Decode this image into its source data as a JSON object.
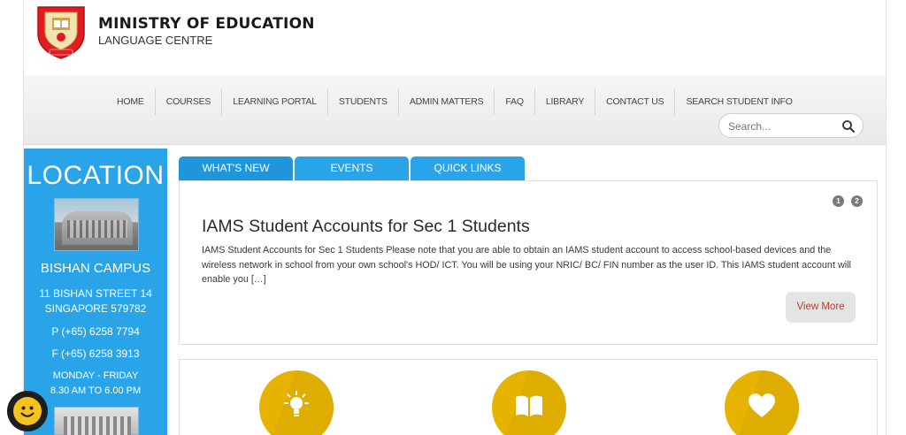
{
  "header": {
    "title": "MINISTRY OF EDUCATION",
    "subtitle": "LANGUAGE CENTRE",
    "logo_icon": "moe-crest-icon",
    "logo_text": "SINGAPORE"
  },
  "nav": {
    "items": [
      {
        "label": "HOME"
      },
      {
        "label": "COURSES"
      },
      {
        "label": "LEARNING PORTAL"
      },
      {
        "label": "STUDENTS"
      },
      {
        "label": "ADMIN MATTERS"
      },
      {
        "label": "FAQ"
      },
      {
        "label": "LIBRARY"
      },
      {
        "label": "CONTACT US"
      },
      {
        "label": "SEARCH STUDENT INFO"
      }
    ],
    "search": {
      "placeholder": "Search...",
      "icon": "search-icon"
    }
  },
  "sidebar": {
    "title": "LOCATION",
    "campus_name": "BISHAN CAMPUS",
    "address_line1": "11 BISHAN STREET 14",
    "address_line2": "SINGAPORE 579782",
    "phone": "P (+65) 6258 7794",
    "fax": "F (+65) 6258 3913",
    "hours_days": "MONDAY - FRIDAY",
    "hours_time": "8.30 AM TO 6.00 PM",
    "color": "#2aa4e8"
  },
  "tabs": [
    {
      "label": "WHAT'S NEW"
    },
    {
      "label": "EVENTS"
    },
    {
      "label": "QUICK LINKS"
    }
  ],
  "news": {
    "pager": [
      "1",
      "2"
    ],
    "title": "IAMS Student Accounts for Sec 1 Students",
    "body": "IAMS Student Accounts for Sec 1 Students Please note that you are able to obtain an IAMS student account to access school-based devices and the wireless network in school from your own school's HOD/ ICT. You will be using your NRIC/ BC/ FIN number as the user ID. This IAMS student account will enable you […]",
    "view_more": "View More"
  },
  "features": [
    {
      "icon": "lightbulb-icon"
    },
    {
      "icon": "book-icon"
    },
    {
      "icon": "heart-icon"
    }
  ],
  "colors": {
    "accent": "#2aa4e8",
    "feature": "#e6b400",
    "link": "#c0392b"
  },
  "chat": {
    "icon": "smiley-chat-icon"
  }
}
